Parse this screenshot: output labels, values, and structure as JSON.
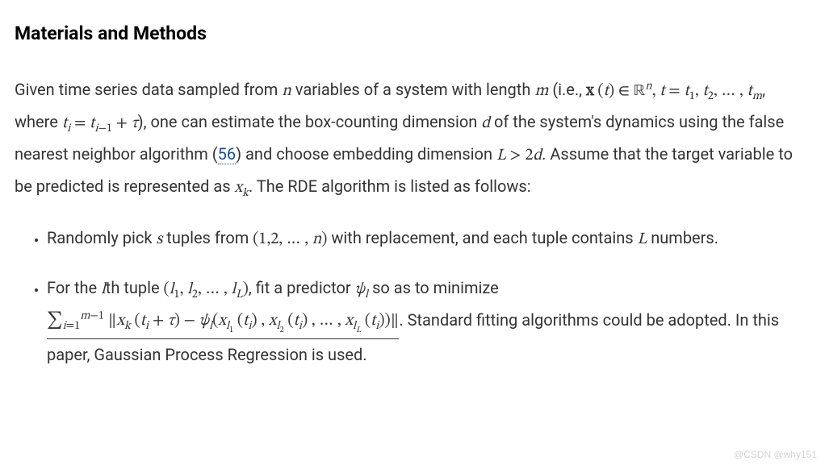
{
  "heading": "Materials and Methods",
  "para": {
    "t0": "Given time series data sampled from ",
    "m1": "n",
    "t1": " variables of a system with length ",
    "m2": "m",
    "t2": " (i.e., ",
    "m3_html": "<span class='rm'><b>x</b> (</span>t<span class='rm'>) ∈ </span><span class='bb rm'>ℝ</span><sup>n</sup><span class='rm'>,</span> t <span class='rm'>=</span> t<sub><span class='rm'>1</span></sub><span class='rm'>,</span> t<sub><span class='rm'>2</span></sub><span class='rm'>, … ,</span> t<sub>m</sub>",
    "t3": ", where ",
    "m4_html": "t<sub>i</sub> <span class='rm'>=</span> t<sub>i<span class='rm'>−1</span></sub> <span class='rm'>+</span> τ",
    "t4": "), one can estimate the box-counting dimension ",
    "m5": "d",
    "t5": " of the system's dynamics using the false nearest neighbor algorithm (",
    "ref": "56",
    "t6": ") and choose embedding dimension ",
    "m6_html": "L <span class='rm'>&gt; 2</span>d",
    "t7": ". Assume that the target variable to be predicted is represented as ",
    "m7_html": "x<sub>k</sub>",
    "t8": ". The RDE algorithm is listed as follows:"
  },
  "li1": {
    "t0": "Randomly pick ",
    "m1": "s",
    "t1": " tuples from ",
    "m2_html": "<span class='rm'>(1,2, … ,</span> n<span class='rm'>)</span>",
    "t2": " with replacement, and each tuple contains ",
    "m3": "L",
    "t3": " numbers."
  },
  "li2": {
    "t0": "For the ",
    "m1": "l",
    "t1": "th tuple ",
    "m2_html": "<span class='rm'>(</span>l<sub><span class='rm'>1</span></sub><span class='rm'>,</span> l<sub><span class='rm'>2</span></sub><span class='rm'>, … ,</span> l<sub>L</sub><span class='rm'>)</span>",
    "t2": ", fit a predictor ",
    "m3_html": "ψ<sub>l</sub>",
    "t3": " so as to minimize ",
    "m4_html": "<span class='sum'><span class='sum-core rm'>∑</span><sub>i<span class='rm'>=1</span></sub><sup>m<span class='rm'>−1</span></sup> <span class='rm'>∥</span>x<sub>k</sub> <span class='rm'>(</span>t<sub>i</sub> <span class='rm'>+</span> τ<span class='rm'>) −</span> ψ<sub>l</sub><span class='rm'>(</span>x<sub>l<sub><span class='rm'>1</span></sub></sub> <span class='rm'>(</span>t<sub>i</sub><span class='rm'>) ,</span> x<sub>l<sub><span class='rm'>2</span></sub></sub> <span class='rm'>(</span>t<sub>i</sub><span class='rm'>) , … ,</span> x<sub>l<sub>L</sub></sub> <span class='rm'>(</span>t<sub>i</sub><span class='rm'>))∥</span></span>",
    "t4": ". Standard fitting algorithms could be adopted. In this paper, Gaussian Process Regression is used."
  },
  "watermark": "@CSDN @why151"
}
